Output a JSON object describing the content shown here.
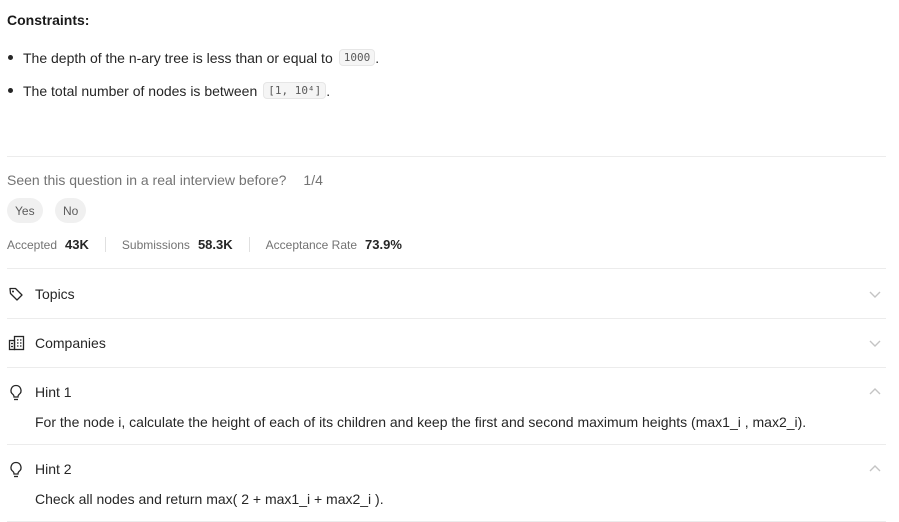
{
  "constraints": {
    "title": "Constraints:",
    "items": [
      {
        "text": "The depth of the n-ary tree is less than or equal to",
        "code": "1000",
        "suffix": "."
      },
      {
        "text": "The total number of nodes is between",
        "code": "[1, 10⁴]",
        "suffix": "."
      }
    ]
  },
  "interview": {
    "question": "Seen this question in a real interview before?",
    "count": "1/4",
    "yes_label": "Yes",
    "no_label": "No"
  },
  "stats": [
    {
      "label": "Accepted",
      "value": "43K"
    },
    {
      "label": "Submissions",
      "value": "58.3K"
    },
    {
      "label": "Acceptance Rate",
      "value": "73.9%"
    }
  ],
  "sections": {
    "topics": {
      "label": "Topics",
      "icon": "tag-icon"
    },
    "companies": {
      "label": "Companies",
      "icon": "building-icon"
    },
    "hint1": {
      "label": "Hint 1",
      "icon": "lightbulb-icon",
      "text": "For the node i, calculate the height of each of its children and keep the first and second maximum heights (max1_i , max2_i)."
    },
    "hint2": {
      "label": "Hint 2",
      "icon": "lightbulb-icon",
      "text": "Check all nodes and return max( 2 + max1_i + max2_i )."
    }
  },
  "colors": {
    "text": "#262626",
    "muted": "#737373",
    "border": "#ececec",
    "pill_bg": "#f0f0f0"
  }
}
